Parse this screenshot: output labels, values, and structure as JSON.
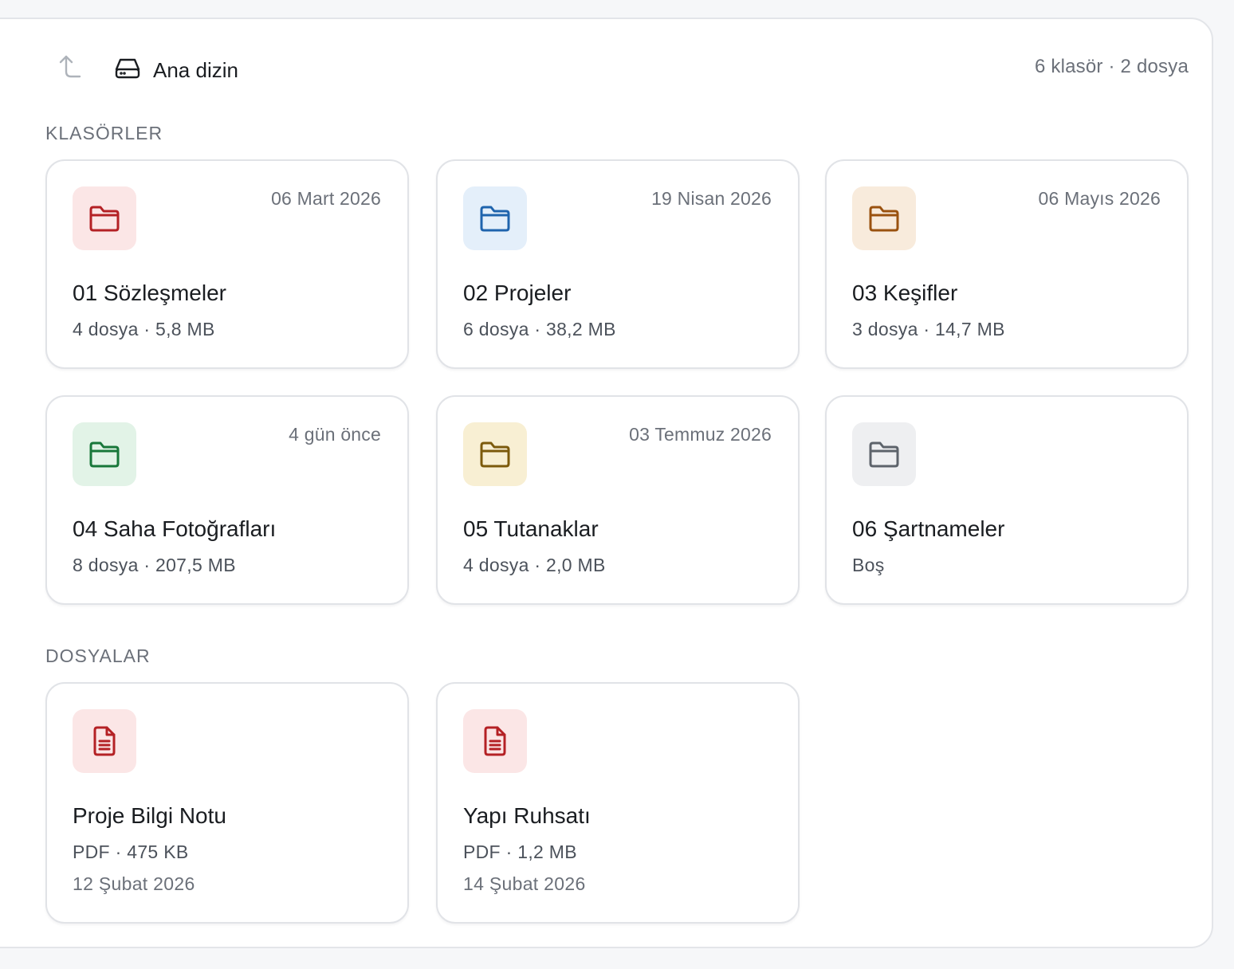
{
  "header": {
    "root_label": "Ana dizin",
    "counts": "6 klasör · 2 dosya"
  },
  "icons": {
    "up": "arrow-up-left-icon",
    "root": "hard-drive-icon",
    "folder": "folder-icon",
    "file": "document-icon"
  },
  "sections": {
    "folders_title": "KLASÖRLER",
    "files_title": "DOSYALAR"
  },
  "folders": [
    {
      "name": "01 Sözleşmeler",
      "date": "06 Mart 2026",
      "meta": "4 dosya · 5,8 MB",
      "tile_bg": "#fbe6e6",
      "icon_color": "#b42125"
    },
    {
      "name": "02 Projeler",
      "date": "19 Nisan 2026",
      "meta": "6 dosya · 38,2 MB",
      "tile_bg": "#e4effa",
      "icon_color": "#1f64ad"
    },
    {
      "name": "03 Keşifler",
      "date": "06 Mayıs 2026",
      "meta": "3 dosya · 14,7 MB",
      "tile_bg": "#f8ebdc",
      "icon_color": "#9a520f"
    },
    {
      "name": "04 Saha Fotoğrafları",
      "date": "4 gün önce",
      "meta": "8 dosya · 207,5 MB",
      "tile_bg": "#e2f3e7",
      "icon_color": "#18773a"
    },
    {
      "name": "05 Tutanaklar",
      "date": "03 Temmuz 2026",
      "meta": "4 dosya · 2,0 MB",
      "tile_bg": "#f8efd3",
      "icon_color": "#7c5a0c"
    },
    {
      "name": "06 Şartnameler",
      "date": "",
      "meta": "Boş",
      "tile_bg": "#eeeff1",
      "icon_color": "#5d636b"
    }
  ],
  "files": [
    {
      "name": "Proje Bilgi Notu",
      "meta": "PDF · 475 KB",
      "date": "12 Şubat 2026",
      "tile_bg": "#fbe6e6",
      "icon_color": "#b42125"
    },
    {
      "name": "Yapı Ruhsatı",
      "meta": "PDF · 1,2 MB",
      "date": "14 Şubat 2026",
      "tile_bg": "#fbe6e6",
      "icon_color": "#b42125"
    }
  ]
}
